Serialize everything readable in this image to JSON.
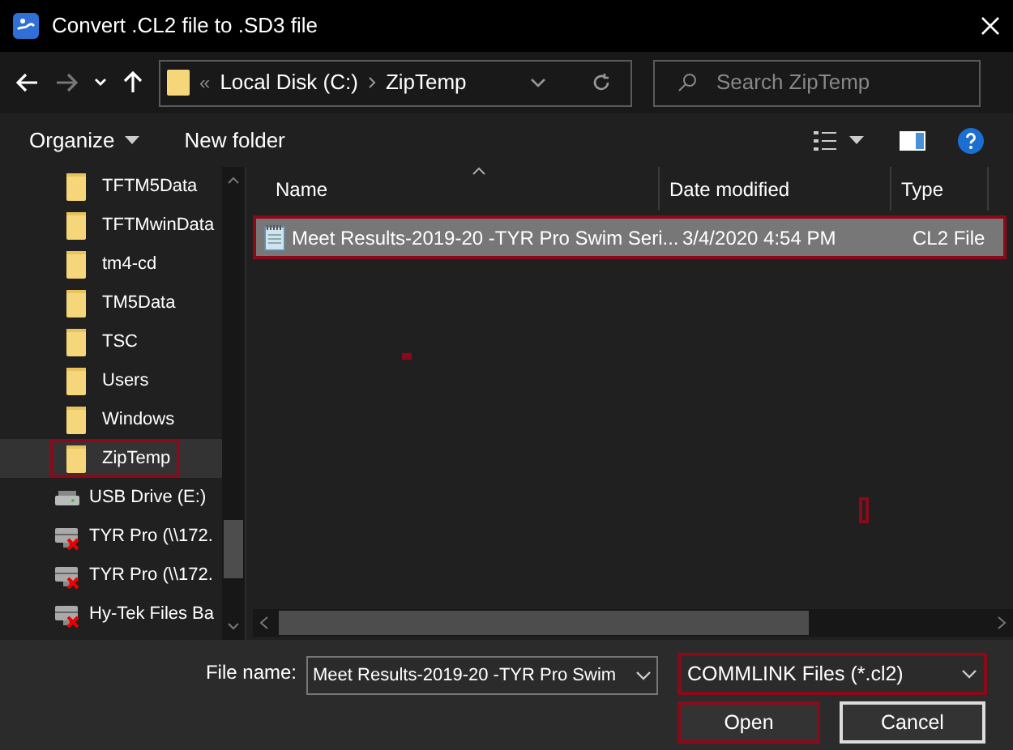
{
  "window": {
    "title": "Convert .CL2 file to .SD3 file"
  },
  "address_bar": {
    "overflow": "«",
    "path": [
      "Local Disk (C:)",
      "ZipTemp"
    ]
  },
  "search": {
    "placeholder": "Search ZipTemp"
  },
  "toolbar": {
    "organize": "Organize",
    "new_folder": "New folder"
  },
  "sidebar": {
    "items": [
      {
        "label": "TFTM5Data",
        "kind": "folder",
        "selected": false
      },
      {
        "label": "TFTMwinData",
        "kind": "folder",
        "selected": false
      },
      {
        "label": "tm4-cd",
        "kind": "folder",
        "selected": false
      },
      {
        "label": "TM5Data",
        "kind": "folder",
        "selected": false
      },
      {
        "label": "TSC",
        "kind": "folder",
        "selected": false
      },
      {
        "label": "Users",
        "kind": "folder",
        "selected": false
      },
      {
        "label": "Windows",
        "kind": "folder",
        "selected": false
      },
      {
        "label": "ZipTemp",
        "kind": "folder",
        "selected": true
      },
      {
        "label": "USB Drive (E:)",
        "kind": "drive",
        "selected": false
      },
      {
        "label": "TYR Pro (\\\\172.",
        "kind": "network",
        "selected": false
      },
      {
        "label": "TYR Pro (\\\\172.",
        "kind": "network",
        "selected": false
      },
      {
        "label": "Hy-Tek Files Ba",
        "kind": "network",
        "selected": false
      }
    ]
  },
  "file_list": {
    "columns": [
      "Name",
      "Date modified",
      "Type"
    ],
    "rows": [
      {
        "name": "Meet Results-2019-20 -TYR Pro Swim Seri...",
        "date": "3/4/2020 4:54 PM",
        "type": "CL2 File",
        "selected": true
      }
    ]
  },
  "footer": {
    "file_name_label": "File name:",
    "file_name": "Meet Results-2019-20 -TYR Pro Swim",
    "file_type": "COMMLINK Files (*.cl2)",
    "buttons": [
      "Open",
      "Cancel"
    ]
  }
}
